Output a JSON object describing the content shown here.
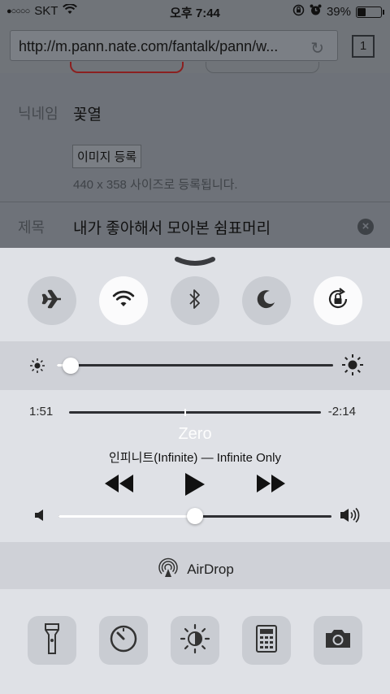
{
  "status_bar": {
    "signal_dots": "●○○○○",
    "carrier": "SKT",
    "time": "오후 7:44",
    "battery_percent": "39%",
    "battery_level": 0.39
  },
  "browser": {
    "url": "http://m.pann.nate.com/fantalk/pann/w...",
    "tab_count": "1"
  },
  "form": {
    "nickname_label": "닉네임",
    "nickname_value": "꽃열",
    "image_button": "이미지 등록",
    "image_hint": "440 x 358 사이즈로 등록됩니다.",
    "title_label": "제목",
    "title_value": "내가 좋아해서 모아본 쉼표머리"
  },
  "control_center": {
    "toggles": [
      {
        "name": "airplane-mode",
        "icon": "airplane-icon",
        "on": false
      },
      {
        "name": "wifi",
        "icon": "wifi-icon",
        "on": true
      },
      {
        "name": "bluetooth",
        "icon": "bluetooth-icon",
        "on": false
      },
      {
        "name": "do-not-disturb",
        "icon": "moon-icon",
        "on": false
      },
      {
        "name": "rotation-lock",
        "icon": "rotation-lock-icon",
        "on": true
      }
    ],
    "brightness_level": 0.05,
    "music": {
      "elapsed": "1:51",
      "remaining": "-2:14",
      "progress": 0.46,
      "song": "Zero",
      "artist_album": "인피니트(Infinite) — Infinite Only",
      "volume_level": 0.5
    },
    "airdrop_label": "AirDrop",
    "tools": [
      {
        "name": "flashlight",
        "icon": "flashlight-icon"
      },
      {
        "name": "timer",
        "icon": "timer-icon"
      },
      {
        "name": "night-shift",
        "icon": "night-shift-icon"
      },
      {
        "name": "calculator",
        "icon": "calculator-icon"
      },
      {
        "name": "camera",
        "icon": "camera-icon"
      }
    ]
  },
  "colors": {
    "dim_background": "#6e7279",
    "panel": "#dfe1e6",
    "panel_alt": "#cfd1d7",
    "toggle_off": "#c9ccd2",
    "toggle_on": "#fbfbfc"
  }
}
